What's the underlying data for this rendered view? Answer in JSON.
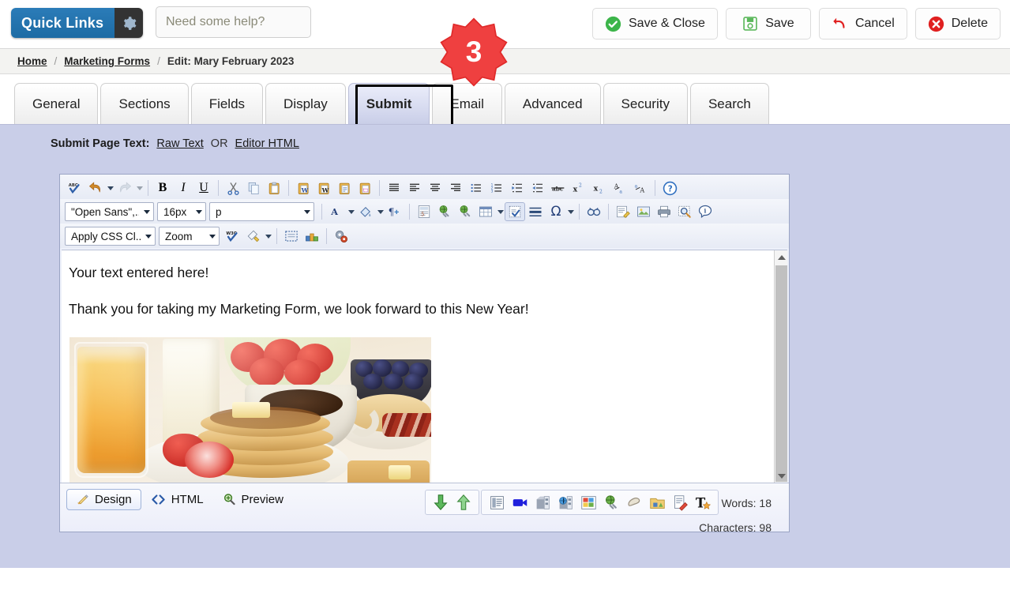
{
  "header": {
    "quick_links_label": "Quick Links",
    "quick_links_icon": "gear-icon",
    "help_placeholder": "Need some help?",
    "help_value": "",
    "buttons": [
      {
        "label": "Save & Close",
        "icon": "check-circle-icon",
        "color": "#3cb54a"
      },
      {
        "label": "Save",
        "icon": "floppy-disk-icon",
        "color": "#5cb85c"
      },
      {
        "label": "Cancel",
        "icon": "undo-arrow-icon",
        "color": "#e02020"
      },
      {
        "label": "Delete",
        "icon": "x-circle-icon",
        "color": "#e02020"
      }
    ]
  },
  "breadcrumb": {
    "home": "Home",
    "section": "Marketing Forms",
    "current": "Edit: Mary February 2023",
    "separator": "/"
  },
  "badge": {
    "number": "3",
    "color": "#ef4040"
  },
  "tabs": [
    {
      "label": "General",
      "active": false
    },
    {
      "label": "Sections",
      "active": false
    },
    {
      "label": "Fields",
      "active": false
    },
    {
      "label": "Display",
      "active": false
    },
    {
      "label": "Submit",
      "active": true
    },
    {
      "label": "Email",
      "active": false
    },
    {
      "label": "Advanced",
      "active": false
    },
    {
      "label": "Security",
      "active": false
    },
    {
      "label": "Search",
      "active": false
    }
  ],
  "submit_page_text": {
    "label": "Submit Page Text:",
    "raw_text_link": "Raw Text",
    "or": "OR",
    "editor_html_link": "Editor HTML"
  },
  "editor": {
    "toolbar_row1": [
      {
        "name": "spellcheck-icon",
        "has_arrow": false
      },
      {
        "name": "undo-icon",
        "has_arrow": true
      },
      {
        "name": "redo-icon",
        "has_arrow": true,
        "disabled": true
      },
      {
        "name": "bold-icon",
        "label": "B"
      },
      {
        "name": "italic-icon",
        "label": "I"
      },
      {
        "name": "underline-icon",
        "label": "U"
      },
      {
        "name": "cut-icon"
      },
      {
        "name": "copy-icon"
      },
      {
        "name": "paste-icon"
      },
      {
        "name": "paste-from-word-icon"
      },
      {
        "name": "paste-from-word-clean-icon"
      },
      {
        "name": "paste-as-text-icon"
      },
      {
        "name": "paste-special-icon"
      },
      {
        "name": "justify-icon"
      },
      {
        "name": "align-left-icon"
      },
      {
        "name": "align-center-icon"
      },
      {
        "name": "align-right-icon"
      },
      {
        "name": "bulleted-list-icon"
      },
      {
        "name": "numbered-list-icon"
      },
      {
        "name": "indent-icon"
      },
      {
        "name": "outdent-icon"
      },
      {
        "name": "strikethrough-icon",
        "label": "abc"
      },
      {
        "name": "superscript-icon"
      },
      {
        "name": "subscript-icon"
      },
      {
        "name": "uppercase-icon"
      },
      {
        "name": "lowercase-icon"
      },
      {
        "name": "help-icon"
      }
    ],
    "font_family": "\"Open Sans\",...",
    "font_size": "16px",
    "paragraph_format": "p",
    "toolbar_row2": [
      {
        "name": "text-color-icon",
        "has_arrow": true
      },
      {
        "name": "background-color-icon",
        "has_arrow": true
      },
      {
        "name": "paragraph-insert-icon"
      },
      {
        "name": "form-field-icon"
      },
      {
        "name": "insert-link-icon"
      },
      {
        "name": "unlink-icon"
      },
      {
        "name": "table-icon",
        "has_arrow": true
      },
      {
        "name": "checkbox-field-icon",
        "active": true
      },
      {
        "name": "horizontal-rule-icon"
      },
      {
        "name": "special-character-icon",
        "label": "Ω",
        "has_arrow": true
      },
      {
        "name": "find-replace-icon"
      },
      {
        "name": "source-edit-icon"
      },
      {
        "name": "insert-image-icon"
      },
      {
        "name": "print-icon"
      },
      {
        "name": "preview-icon"
      },
      {
        "name": "about-icon"
      }
    ],
    "css_class": "Apply CSS Cl...",
    "zoom": "Zoom",
    "toolbar_row3": [
      {
        "name": "w3c-validate-icon",
        "label": "W3C"
      },
      {
        "name": "format-painter-icon",
        "has_arrow": true
      },
      {
        "name": "show-blocks-icon"
      },
      {
        "name": "templates-icon"
      },
      {
        "name": "settings-gears-icon"
      }
    ],
    "body": {
      "line1": "Your text entered here!",
      "line2": "Thank you for taking my Marketing Form, we look forward to this New Year!",
      "image_alt": "breakfast-photo"
    },
    "scrollbar": {
      "name": "vertical-scrollbar"
    }
  },
  "status_bar": {
    "modes": [
      {
        "label": "Design",
        "icon": "pencil-icon",
        "active": true
      },
      {
        "label": "HTML",
        "icon": "code-icon",
        "active": false
      },
      {
        "label": "Preview",
        "icon": "magnifier-icon",
        "active": false
      }
    ],
    "bottom_icons_group1": [
      {
        "name": "move-down-icon"
      },
      {
        "name": "move-up-icon"
      }
    ],
    "bottom_icons_group2": [
      {
        "name": "form-list-icon"
      },
      {
        "name": "video-camera-icon"
      },
      {
        "name": "media-box-icon"
      },
      {
        "name": "web-box-icon"
      },
      {
        "name": "gallery-icon"
      },
      {
        "name": "globe-link-icon"
      },
      {
        "name": "clip-icon"
      },
      {
        "name": "folder-shapes-icon"
      },
      {
        "name": "document-edit-icon"
      },
      {
        "name": "text-style-icon"
      }
    ],
    "words_label": "Words: 18",
    "characters_label": "Characters: 98"
  }
}
